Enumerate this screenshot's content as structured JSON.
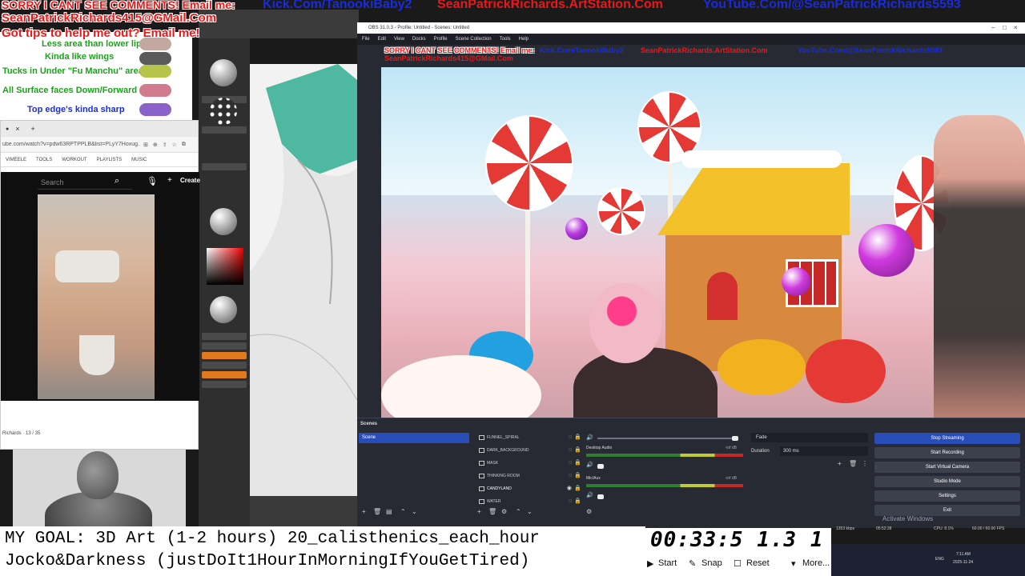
{
  "banner": {
    "line1_left": "SORRY I CANT SEE COMMENTS! Email me:",
    "kick": "Kick.Com/TanookiBaby2",
    "artstation": "SeanPatrickRichards.ArtStation.Com",
    "youtube": "YouTube.Com/@SeanPatrickRichards5593",
    "email": "SeanPatrickRichards415@GMail.Com",
    "tips": "Got tips to help me out? Email me!"
  },
  "reference_notes": [
    {
      "text": "Less area than lower lip",
      "color": "#1aa31a"
    },
    {
      "text": "Kinda like wings",
      "color": "#1aa31a"
    },
    {
      "text": "Tucks in Under \"Fu Manchu\" area",
      "color": "#1aa31a"
    },
    {
      "text": "All Surface faces Down/Forward",
      "color": "#1aa31a"
    },
    {
      "text": "Top edge's kinda sharp",
      "color": "#1a2cd8"
    }
  ],
  "browser": {
    "tab_close": "×",
    "tab_new": "+",
    "url": "ube.com/watch?v=pdw63RPTPPLB&list=PLyY7Hoxug...",
    "bookmarks": [
      "VIMEELE",
      "TOOLS",
      "WORKOUT",
      "PLAYLISTS",
      "MUSIC"
    ],
    "search_placeholder": "Search",
    "create_label": "Create",
    "page_count": "Richards · 13 / 35"
  },
  "obs": {
    "title": "OBS 31.0.3 - Profile: Untitled - Scenes: Untitled",
    "menu": [
      "File",
      "Edit",
      "View",
      "Docks",
      "Profile",
      "Scene Collection",
      "Tools",
      "Help"
    ],
    "scenes_header": "Scenes",
    "scene_selected": "Scene",
    "sources": [
      {
        "name": "FUNNEL_SPIRAL",
        "visible": false
      },
      {
        "name": "DARK_BACKGROUND",
        "visible": false
      },
      {
        "name": "MASK",
        "visible": false
      },
      {
        "name": "THINKING ROOM",
        "visible": false
      },
      {
        "name": "CANDYLAND",
        "visible": true
      },
      {
        "name": "WATER",
        "visible": false
      }
    ],
    "mixer": [
      {
        "label": "",
        "db": ""
      },
      {
        "label": "Desktop Audio",
        "db": "-inf dB"
      },
      {
        "label": "Mic/Aux",
        "db": "-inf dB"
      }
    ],
    "transition": "Fade",
    "duration_label": "Duration",
    "duration_value": "300 ms",
    "controls": [
      {
        "label": "Stop Streaming",
        "active": true
      },
      {
        "label": "Start Recording",
        "active": false
      },
      {
        "label": "Start Virtual Camera",
        "active": false
      },
      {
        "label": "Studio Mode",
        "active": false
      },
      {
        "label": "Settings",
        "active": false
      },
      {
        "label": "Exit",
        "active": false
      }
    ],
    "activate_windows": "Activate Windows",
    "status": {
      "bitrate": "1353 kbps",
      "time": "05:52:38",
      "cpu": "CPU: 8.1%",
      "fps": "60.00 / 60.00 FPS"
    }
  },
  "goal": {
    "line1": "MY GOAL: 3D Art (1-2 hours) 20_calisthenics_each_hour",
    "line2": "Jocko&Darkness (justDoIt1HourInMorningIfYouGetTired)"
  },
  "timer": {
    "value": "00:33:5 1.3 1",
    "start": "Start",
    "snap": "Snap",
    "reset": "Reset",
    "more": "More..."
  },
  "taskbar": {
    "lang": "ENG",
    "time": "7:11 AM",
    "date": "2025-11-24"
  }
}
